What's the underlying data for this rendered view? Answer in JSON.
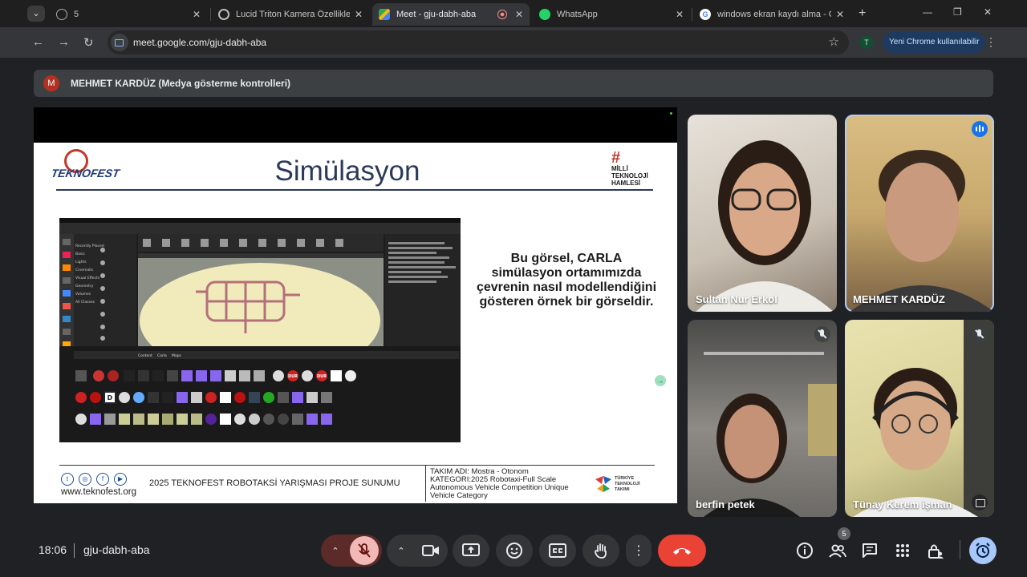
{
  "browser": {
    "tabs": [
      {
        "title": "5"
      },
      {
        "title": "Lucid Triton Kamera Özellikleri"
      },
      {
        "title": "Meet - gju-dabh-aba"
      },
      {
        "title": "WhatsApp"
      },
      {
        "title": "windows ekran kaydı alma - Go"
      }
    ],
    "url": "meet.google.com/gju-dabh-aba",
    "profile_initial": "T",
    "new_chrome_label": "Yeni Chrome kullanılabilir"
  },
  "presenter": {
    "initial": "M",
    "text": "MEHMET KARDÜZ (Medya gösterme kontrolleri)"
  },
  "slide": {
    "title": "Simülasyon",
    "logo_left_text": "TEKNOFEST",
    "logo_right_lines": [
      "MİLLİ",
      "TEKNOLOJİ",
      "HAMLESİ"
    ],
    "caption_lines": [
      "Bu görsel, CARLA",
      "simülasyon ortamımızda",
      "çevrenin nasıl modellendiğini",
      "gösteren örnek bir görseldir."
    ],
    "footer_site": "www.teknofest.org",
    "footer_title": "2025 TEKNOFEST ROBOTAKSİ YARIŞMASI PROJE SUNUMU",
    "footer_team_lines": [
      "TAKIM ADI: Mostra - Otonom",
      "KATEGORI:2025 Robotaxi-Full Scale",
      "Autonomous Vehicle Competition Unique",
      "Vehicle Category"
    ],
    "tta_lines": [
      "TÜRKİYE",
      "TEKNOLOJİ",
      "TAKIMI"
    ],
    "editor": {
      "left_panel_items": [
        "Recently Placed",
        "Basic",
        "Lights",
        "Cinematic",
        "Visual Effects",
        "Geometry",
        "Volumes",
        "All Classes"
      ],
      "content_tab_labels": [
        "Content",
        "Carla",
        "Maps"
      ],
      "stop_sign_text": "DUR",
      "d_tile": "D"
    }
  },
  "participants": [
    {
      "name": "Sultan Nur Erkol",
      "status": "none"
    },
    {
      "name": "MEHMET KARDÜZ",
      "status": "speaking"
    },
    {
      "name": "berfin petek",
      "status": "muted"
    },
    {
      "name": "Tünay Kerem işman",
      "status": "muted"
    }
  ],
  "bottom": {
    "time": "18:06",
    "meeting_code": "gju-dabh-aba",
    "people_count": "5"
  },
  "colors": {
    "end_call": "#ea4335",
    "speaking_badge": "#1a73e8",
    "slide_title": "#2b3a5a"
  }
}
